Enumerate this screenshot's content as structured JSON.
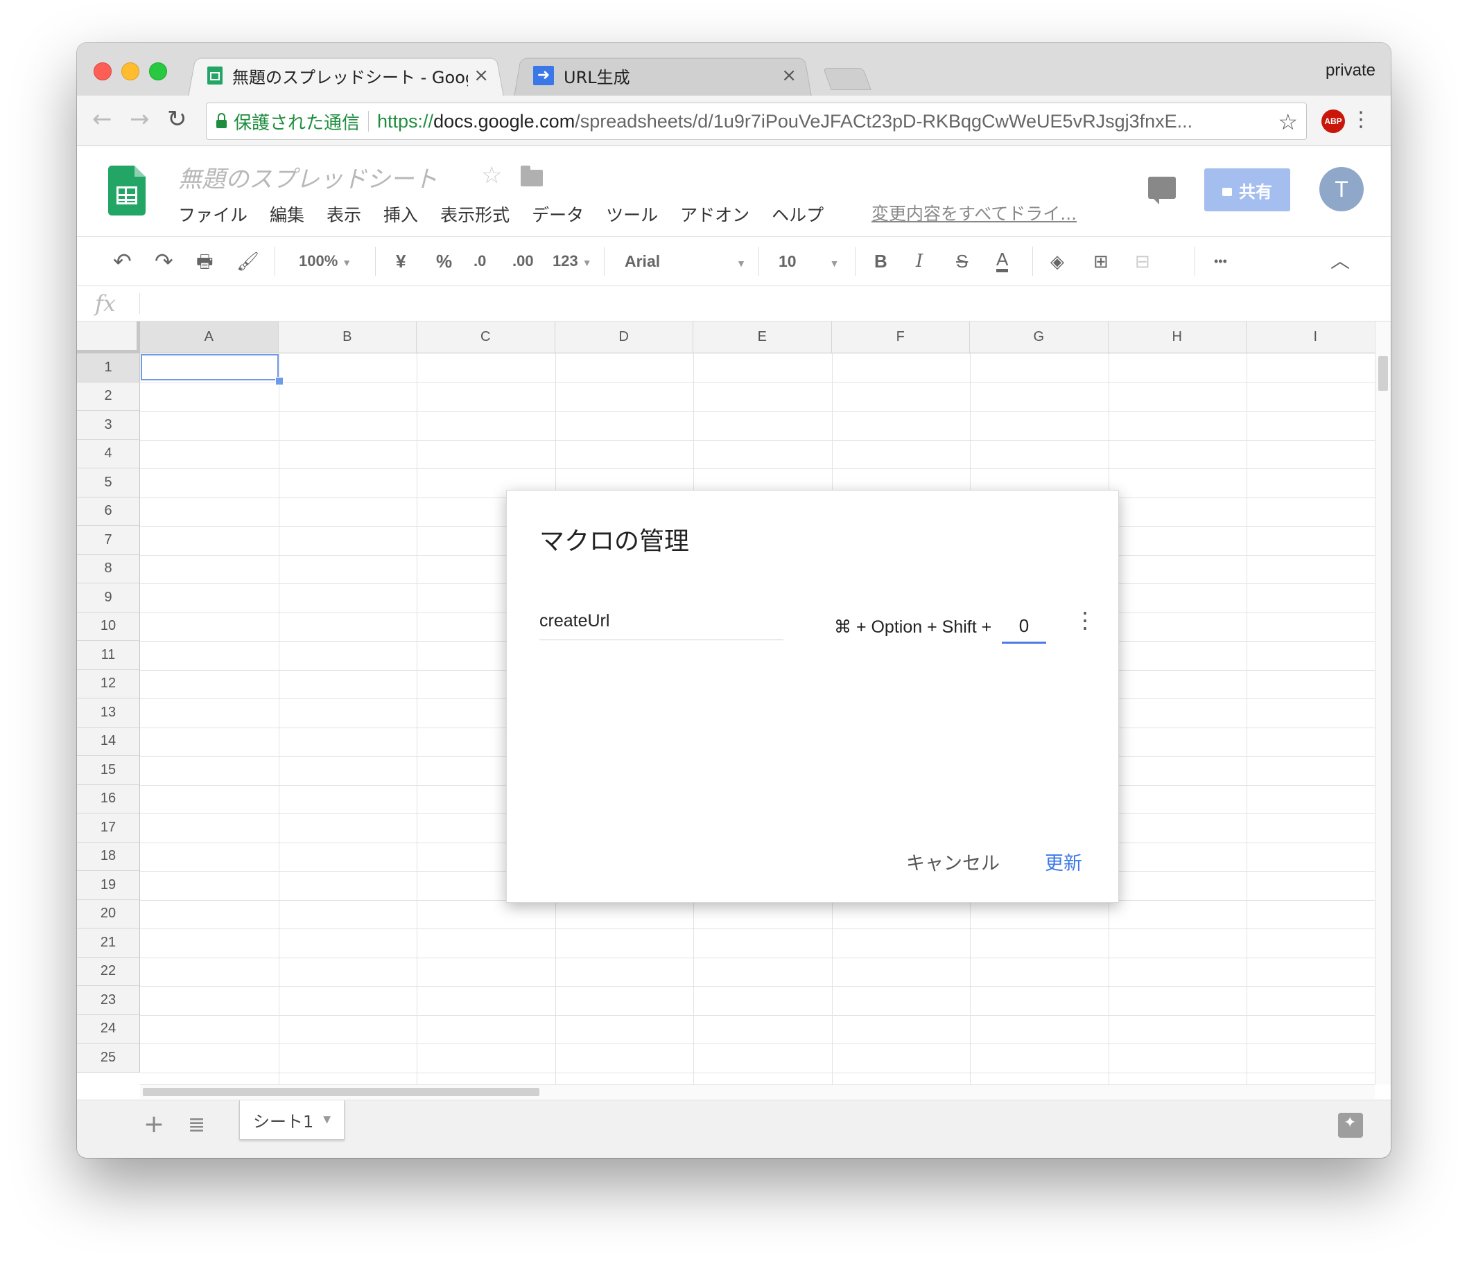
{
  "browser": {
    "tabs": [
      {
        "title": "無題のスプレッドシート - Google スプレッドシート",
        "close": "×"
      },
      {
        "title": "URL生成",
        "close": "×"
      }
    ],
    "profile": "private",
    "secure_label": "保護された通信",
    "url_scheme": "https://",
    "url_host": "docs.google.com",
    "url_path": "/spreadsheets/d/1u9r7iPouVeJFACt23pD-RKBqgCwWeUE5vRJsgj3fnxE...",
    "abp_label": "ABP"
  },
  "doc": {
    "title": "無題のスプレッドシート",
    "menu": [
      "ファイル",
      "編集",
      "表示",
      "挿入",
      "表示形式",
      "データ",
      "ツール",
      "アドオン",
      "ヘルプ"
    ],
    "save_status": "変更内容をすべてドライ...",
    "share_label": "共有",
    "avatar_letter": "T"
  },
  "format_toolbar": {
    "zoom": "100%",
    "currency": "¥",
    "percent": "%",
    "decimal_dec": ".0",
    "decimal_inc": ".00",
    "number_format": "123",
    "font": "Arial",
    "font_size": "10",
    "bold": "B",
    "italic": "I",
    "strike": "S",
    "text_color": "A",
    "more": "•••"
  },
  "formula_bar": {
    "fx_label": "fx"
  },
  "grid": {
    "columns": [
      "A",
      "B",
      "C",
      "D",
      "E",
      "F",
      "G",
      "H",
      "I"
    ],
    "rows": [
      "1",
      "2",
      "3",
      "4",
      "5",
      "6",
      "7",
      "8",
      "9",
      "10",
      "11",
      "12",
      "13",
      "14",
      "15",
      "16",
      "17",
      "18",
      "19",
      "20",
      "21",
      "22",
      "23",
      "24",
      "25"
    ],
    "selected_cell": "A1"
  },
  "sheets": {
    "tabs": [
      "シート1"
    ]
  },
  "dialog": {
    "title": "マクロの管理",
    "macros": [
      {
        "name": "createUrl",
        "shortcut_prefix": "⌘ + Option + Shift +",
        "shortcut_key": "0"
      }
    ],
    "cancel_label": "キャンセル",
    "update_label": "更新"
  },
  "colors": {
    "accent_blue": "#3b78e7",
    "sheets_green": "#23a566",
    "secure_green": "#1e8e3e",
    "share_button": "#a4bef0"
  }
}
